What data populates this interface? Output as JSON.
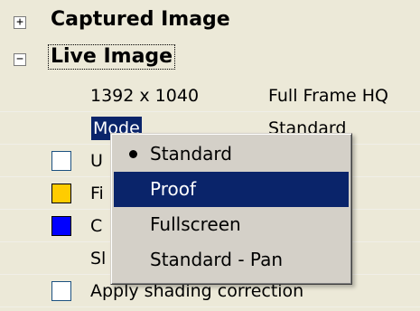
{
  "tree": {
    "captured": {
      "expander": "+",
      "label": "Captured Image"
    },
    "live": {
      "expander": "−",
      "label": "Live Image"
    }
  },
  "properties": [
    {
      "name": "1392 x 1040",
      "value": "Full Frame HQ"
    },
    {
      "name": "Mode",
      "value": "Standard"
    },
    {
      "name": "U",
      "control": "checkbox",
      "checked": false
    },
    {
      "name": "Fi",
      "control": "swatch",
      "color": "#ffcc00"
    },
    {
      "name": "C",
      "control": "swatch",
      "color": "#0000ff"
    },
    {
      "name": "Sl"
    },
    {
      "name": "Apply shading correction",
      "control": "checkbox",
      "checked": false
    }
  ],
  "popup_menu": {
    "items": [
      {
        "label": "Standard",
        "selected": true,
        "highlighted": false
      },
      {
        "label": "Proof",
        "selected": false,
        "highlighted": true
      },
      {
        "label": "Fullscreen",
        "selected": false,
        "highlighted": false
      },
      {
        "label": "Standard - Pan",
        "selected": false,
        "highlighted": false
      }
    ]
  },
  "colors": {
    "selection": "#0a246a",
    "background": "#ece9d8",
    "menu_face": "#d4d0c8"
  }
}
